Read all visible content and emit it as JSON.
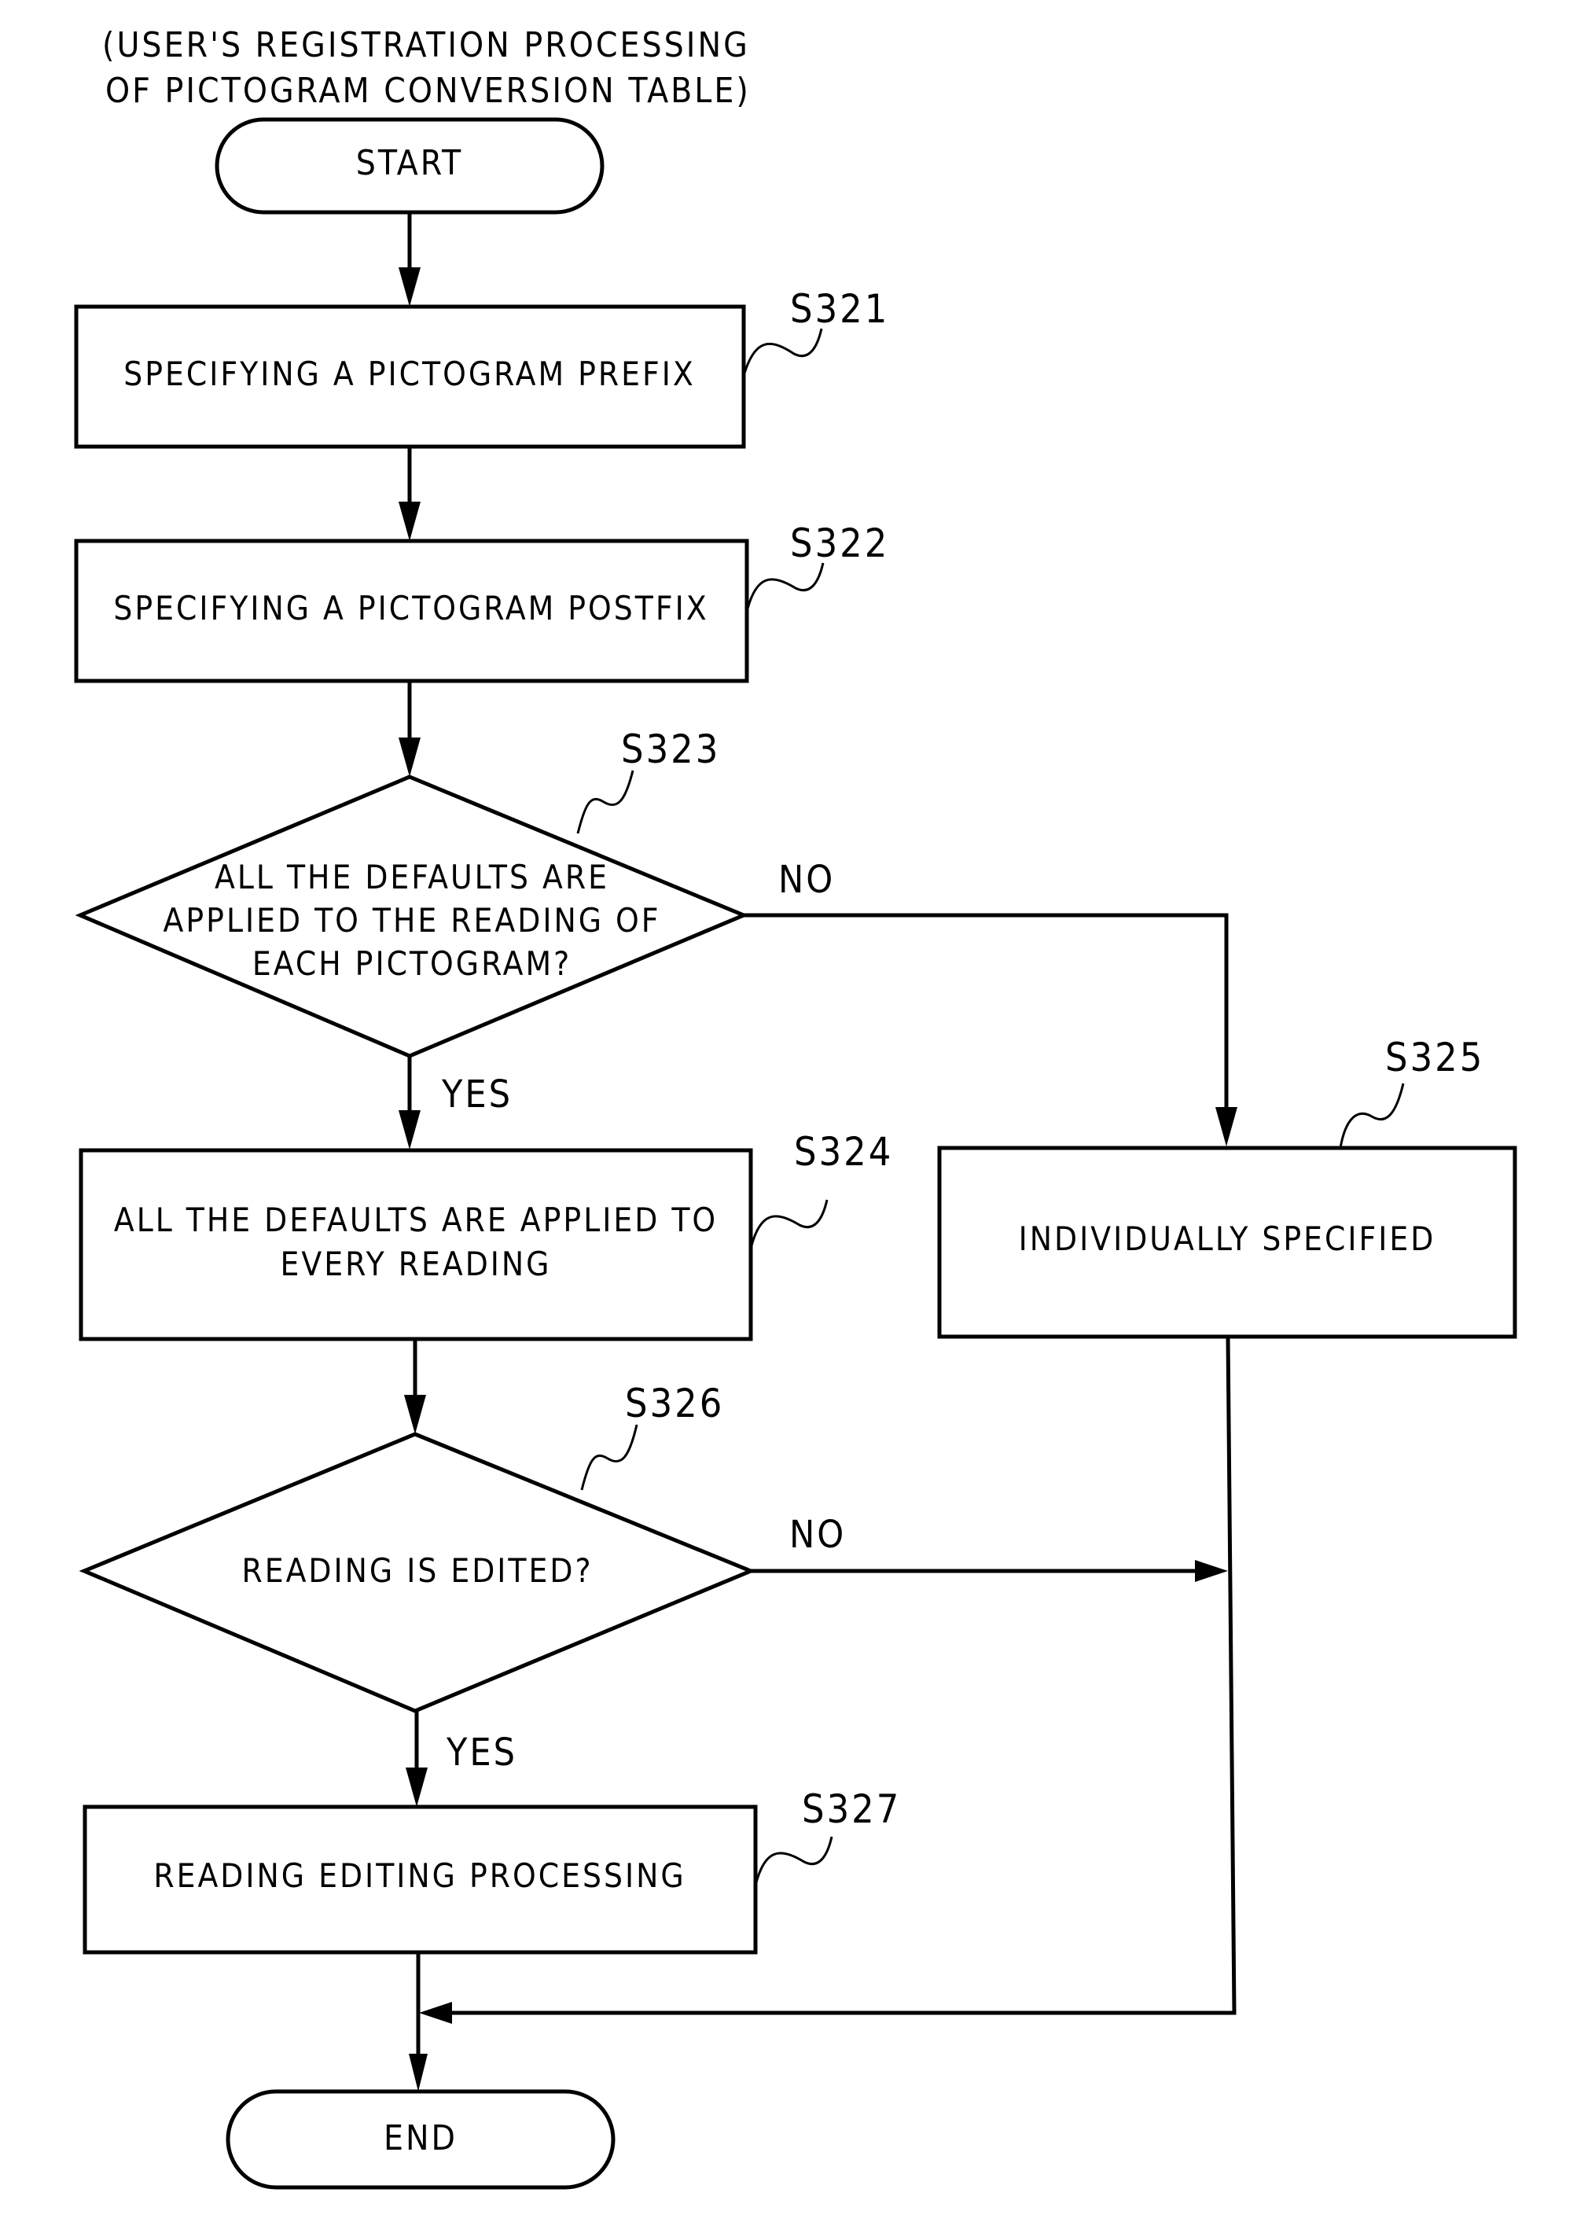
{
  "title": {
    "line1": "(USER'S REGISTRATION PROCESSING",
    "line2": "OF PICTOGRAM CONVERSION TABLE)"
  },
  "terminals": {
    "start": "START",
    "end": "END"
  },
  "steps": {
    "s321": {
      "id": "S321",
      "text": [
        "SPECIFYING A PICTOGRAM PREFIX"
      ]
    },
    "s322": {
      "id": "S322",
      "text": [
        "SPECIFYING A PICTOGRAM POSTFIX"
      ]
    },
    "s323": {
      "id": "S323",
      "text": [
        "ALL THE DEFAULTS ARE",
        "APPLIED TO THE READING OF",
        "EACH PICTOGRAM?"
      ]
    },
    "s324": {
      "id": "S324",
      "text": [
        "ALL THE DEFAULTS ARE APPLIED TO",
        "EVERY READING"
      ]
    },
    "s325": {
      "id": "S325",
      "text": [
        "INDIVIDUALLY SPECIFIED"
      ]
    },
    "s326": {
      "id": "S326",
      "text": [
        "READING IS EDITED?"
      ]
    },
    "s327": {
      "id": "S327",
      "text": [
        "READING EDITING PROCESSING"
      ]
    }
  },
  "branches": {
    "s323_yes": "YES",
    "s323_no": "NO",
    "s326_yes": "YES",
    "s326_no": "NO"
  }
}
